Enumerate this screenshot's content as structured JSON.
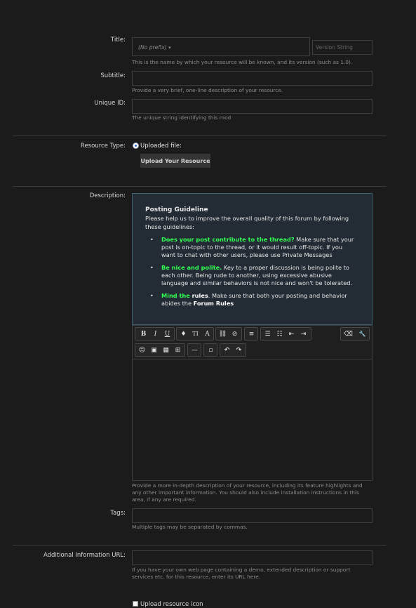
{
  "title_row": {
    "label": "Title:",
    "prefix": "(No prefix)",
    "version_placeholder": "Version String",
    "hint": "This is the name by which your resource will be known, and its version (such as 1.0)."
  },
  "subtitle_row": {
    "label": "Subtitle:",
    "hint": "Provide a very brief, one-line description of your resource."
  },
  "unique_row": {
    "label": "Unique ID:",
    "hint": "The unique string identifying this mod"
  },
  "resource_type": {
    "label": "Resource Type:",
    "option": "Uploaded file:",
    "upload_button": "Upload Your Resource"
  },
  "description": {
    "label": "Description:",
    "guideline_title": "Posting Guideline",
    "guideline_intro": "Please help us to improve the overall quality of this forum by following these guidelines:",
    "items": [
      {
        "bold": "Does your post contribute to the thread?",
        "rest": " Make sure that your post is on-topic to the thread, or it would result off-topic. If you want to chat with other users, please use Private Messages"
      },
      {
        "bold": "Be nice and polite.",
        "rest": " Key to a proper discussion is being polite to each other. Being rude to another, using excessive abusive language and similar behaviors is not nice and won't be tolerated."
      },
      {
        "bold": "Mind the",
        "bold2": " rules",
        "rest": ". Make sure that both your posting and behavior abides the ",
        "link": "Forum Rules"
      }
    ],
    "hint": "Provide a more in-depth description of your resource, including its feature highlights and any other important information. You should also include installation instructions in this area, if any are required."
  },
  "toolbar": {
    "bold": "B",
    "italic": "I",
    "underline": "U",
    "color": "♦",
    "font_size": "TI",
    "font": "A",
    "link": "⛓",
    "unlink": "⊘",
    "align": "≡",
    "ul": "☰",
    "ol": "☷",
    "outdent": "⇤",
    "indent": "⇥",
    "remove_format": "⌫",
    "tools": "🔧",
    "smilies": "☺",
    "image": "▣",
    "media": "▦",
    "table": "⊞",
    "hr": "—",
    "save": "▫",
    "undo": "↶",
    "redo": "↷"
  },
  "tags_row": {
    "label": "Tags:",
    "hint": "Multiple tags may be separated by commas."
  },
  "url_row": {
    "label": "Additional Information URL:",
    "hint": "If you have your own web page containing a demo, extended description or support services etc. for this resource, enter its URL here."
  },
  "icon_row": {
    "label": "Upload resource icon"
  }
}
